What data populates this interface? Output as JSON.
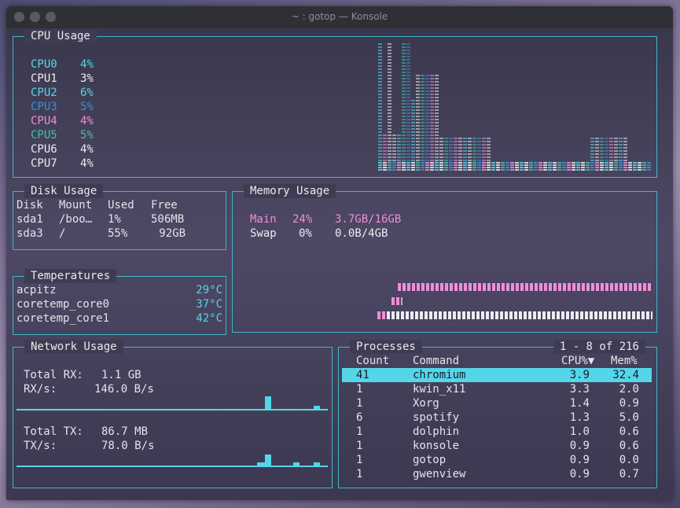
{
  "window": {
    "title": "~ : gotop — Konsole"
  },
  "cpu": {
    "title": "CPU Usage",
    "cores": [
      {
        "name": "CPU0",
        "value": "4%",
        "color": "#55d6e8"
      },
      {
        "name": "CPU1",
        "value": "3%",
        "color": "#ececf0"
      },
      {
        "name": "CPU2",
        "value": "6%",
        "color": "#55d6e8"
      },
      {
        "name": "CPU3",
        "value": "5%",
        "color": "#3b8fd9"
      },
      {
        "name": "CPU4",
        "value": "4%",
        "color": "#ef8ed6"
      },
      {
        "name": "CPU5",
        "value": "5%",
        "color": "#43c0a9"
      },
      {
        "name": "CPU6",
        "value": "4%",
        "color": "#ececf0"
      },
      {
        "name": "CPU7",
        "value": "4%",
        "color": "#ececf0"
      }
    ]
  },
  "disk": {
    "title": "Disk Usage",
    "headers": [
      "Disk",
      "Mount",
      "Used",
      "Free"
    ],
    "rows": [
      [
        "sda1",
        "/boo…",
        "1%",
        "506MB"
      ],
      [
        "sda3",
        "/",
        "55%",
        "92GB"
      ]
    ]
  },
  "memory": {
    "title": "Memory Usage",
    "main": {
      "label": "Main",
      "percent": "24%",
      "value": "3.7GB/16GB",
      "color": "#ef8ed6"
    },
    "swap": {
      "label": "Swap",
      "percent": "0%",
      "value": "0.0B/4GB",
      "color": "#ececf0"
    }
  },
  "temps": {
    "title": "Temperatures",
    "rows": [
      {
        "name": "acpitz",
        "value": "29°C"
      },
      {
        "name": "coretemp_core0",
        "value": "37°C"
      },
      {
        "name": "coretemp_core1",
        "value": "42°C"
      }
    ]
  },
  "network": {
    "title": "Network Usage",
    "rx_total_label": "Total RX:",
    "rx_total": "1.1 GB",
    "rx_rate_label": "RX/s:",
    "rx_rate": "146.0 B/s",
    "tx_total_label": "Total TX:",
    "tx_total": "86.7 MB",
    "tx_rate_label": "TX/s:",
    "tx_rate": "78.0 B/s"
  },
  "processes": {
    "title": "Processes",
    "range": "1 - 8 of 216",
    "headers": {
      "count": "Count",
      "command": "Command",
      "cpu": "CPU%▼",
      "mem": "Mem%"
    },
    "rows": [
      {
        "count": "41",
        "command": "chromium",
        "cpu": "3.9",
        "mem": "32.4"
      },
      {
        "count": "1",
        "command": "kwin_x11",
        "cpu": "3.3",
        "mem": "2.0"
      },
      {
        "count": "1",
        "command": "Xorg",
        "cpu": "1.4",
        "mem": "0.9"
      },
      {
        "count": "6",
        "command": "spotify",
        "cpu": "1.3",
        "mem": "5.0"
      },
      {
        "count": "1",
        "command": "dolphin",
        "cpu": "1.0",
        "mem": "0.6"
      },
      {
        "count": "1",
        "command": "konsole",
        "cpu": "0.9",
        "mem": "0.6"
      },
      {
        "count": "1",
        "command": "gotop",
        "cpu": "0.9",
        "mem": "0.0"
      },
      {
        "count": "1",
        "command": "gwenview",
        "cpu": "0.9",
        "mem": "0.7"
      }
    ]
  }
}
